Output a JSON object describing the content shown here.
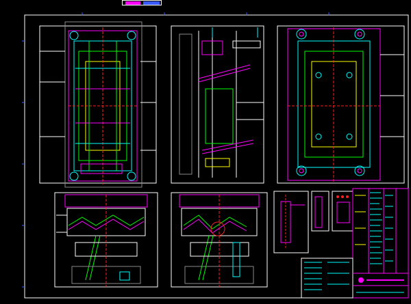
{
  "drawing": {
    "background": "#000000",
    "colors": {
      "frame": "#ffffff",
      "outline": "#ffffff",
      "magenta": "#ff00ff",
      "cyan": "#00ffff",
      "green": "#00ff00",
      "yellow": "#ffff00",
      "red": "#ff2020",
      "blue": "#3a5bff",
      "grey": "#8a8a8a"
    },
    "views": [
      "mold-top-view",
      "mold-section-view",
      "mold-bottom-view",
      "front-section-view",
      "side-section-view",
      "detail-views"
    ],
    "title_block_present": true
  }
}
